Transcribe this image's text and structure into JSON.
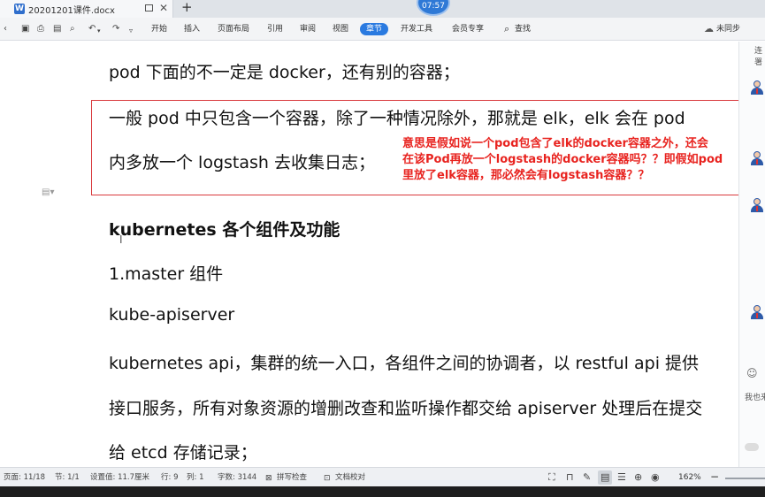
{
  "titlebar": {
    "doc_title": "20201201课件.docx",
    "doc_icon_letter": "W",
    "close_glyph": "✕",
    "new_tab_glyph": "+",
    "clock_text": "07:57"
  },
  "toolbar": {
    "menu": [
      "开始",
      "插入",
      "页面布局",
      "引用",
      "审阅",
      "视图",
      "章节",
      "开发工具",
      "会员专享"
    ],
    "active_menu": "章节",
    "search_label": "查找",
    "cloud_label": "未同步"
  },
  "document": {
    "paragraphs": [
      "pod 下面的不一定是 docker，还有别的容器；",
      "一般 pod 中只包含一个容器，除了一种情况除外，那就是 elk，elk 会在 pod",
      "内多放一个 logstash 去收集日志；",
      "kubernetes 各个组件及功能",
      "1.master 组件",
      "kube-apiserver",
      "kubernetes api，集群的统一入口，各组件之间的协调者，以 restful api 提供",
      "接口服务，所有对象资源的增删改查和监听操作都交给 apiserver 处理后在提交",
      "给 etcd 存储记录；"
    ],
    "annotation": [
      "意思是假如说一个pod包含了elk的docker容器之外，还会",
      "在该Pod再放一个logstash的docker容器吗？？即假如pod",
      "里放了elk容器，那必然会有logstash容器？？"
    ],
    "annotation_color": "#e8231f",
    "highlight_color": "#d9393c"
  },
  "right_panel": {
    "top_label": "连署",
    "input_label": "我也来"
  },
  "statusbar": {
    "page": "页面: 11/18",
    "section": "节: 1/1",
    "setting": "设置值: 11.7厘米",
    "row": "行: 9",
    "col": "列: 1",
    "word_count": "字数: 3144",
    "spell_check": "拼写检查",
    "doc_proof": "文档校对",
    "zoom": "162%"
  }
}
